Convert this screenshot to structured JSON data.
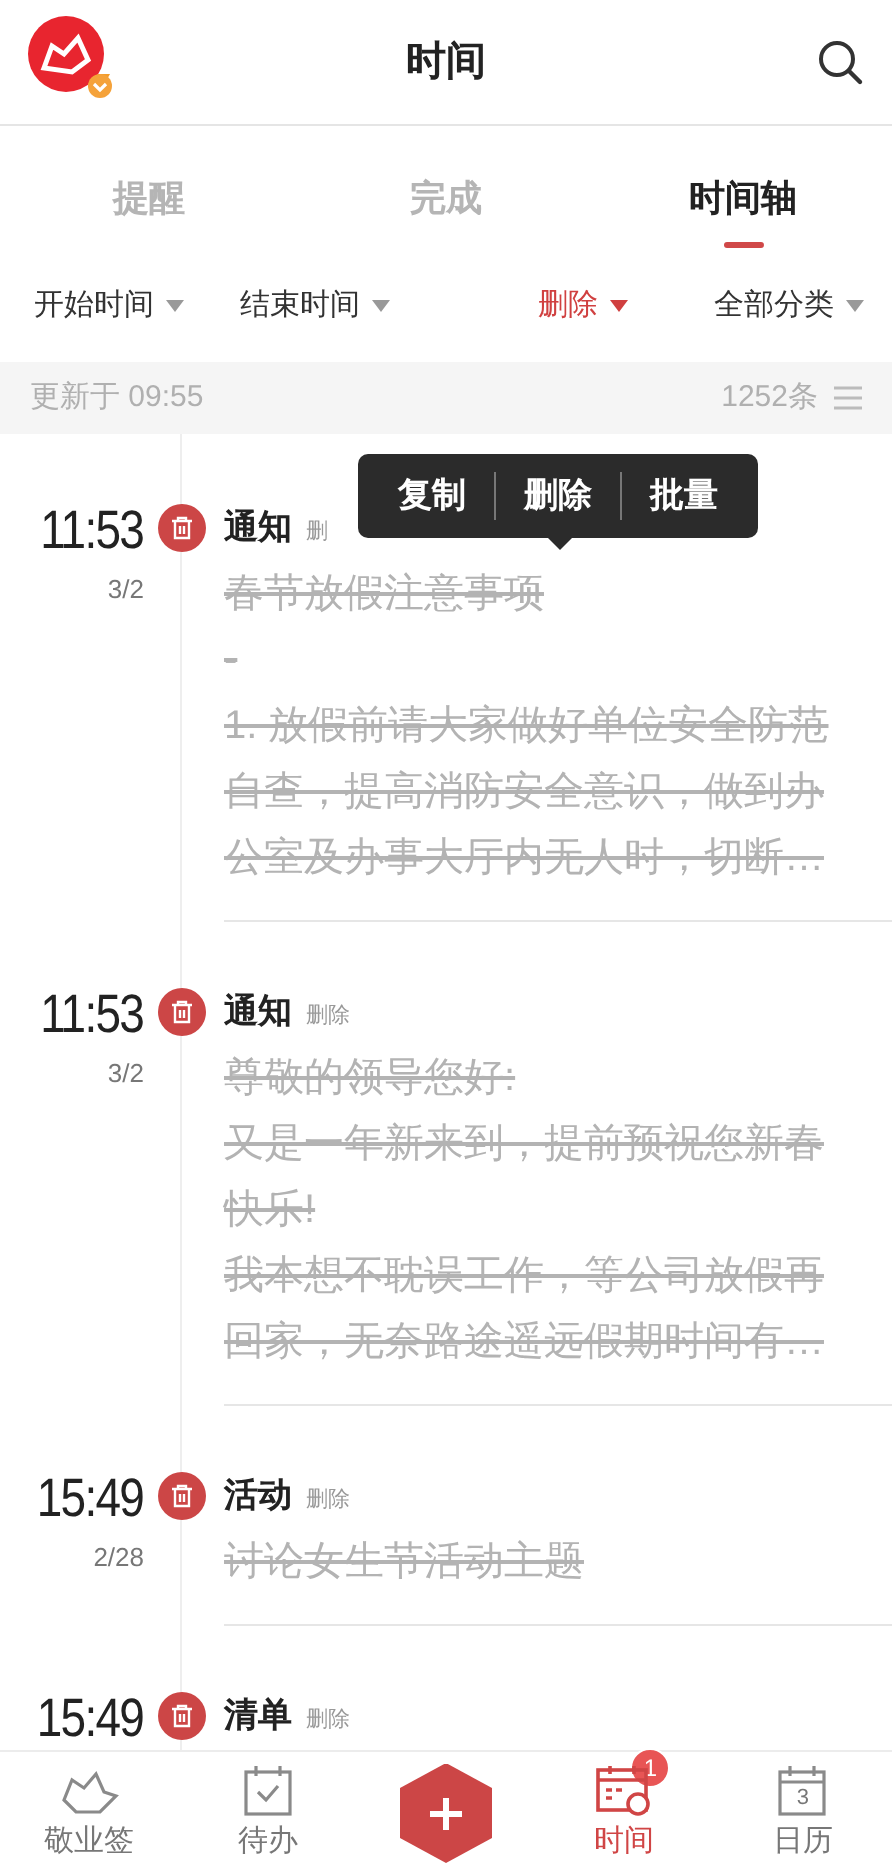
{
  "header": {
    "title": "时间"
  },
  "tabs": [
    {
      "label": "提醒",
      "selected": false
    },
    {
      "label": "完成",
      "selected": false
    },
    {
      "label": "时间轴",
      "selected": true
    }
  ],
  "filters": [
    {
      "label": "开始时间",
      "selected": false
    },
    {
      "label": "结束时间",
      "selected": false
    },
    {
      "label": "删除",
      "selected": true
    },
    {
      "label": "全部分类",
      "selected": false
    }
  ],
  "status_bar": {
    "updated": "更新于 09:55",
    "count": "1252条"
  },
  "popup_menu": [
    "复制",
    "删除",
    "批量"
  ],
  "entries": [
    {
      "time": "11:53",
      "date": "3/2",
      "category": "通知",
      "status": "删",
      "struck": true,
      "lines": [
        "春节放假注意事项",
        "-",
        "1. 放假前请大家做好单位安全防范",
        "自查，提高消防安全意识，做到办",
        "公室及办事大厅内无人时，切断…"
      ]
    },
    {
      "time": "11:53",
      "date": "3/2",
      "category": "通知",
      "status": "删除",
      "struck": true,
      "lines": [
        "尊敬的领导您好:",
        "又是一年新来到，提前预祝您新春",
        "快乐!",
        "我本想不耽误工作，等公司放假再",
        "回家，无奈路途遥远假期时间有…"
      ]
    },
    {
      "time": "15:49",
      "date": "2/28",
      "category": "活动",
      "status": "删除",
      "struck": true,
      "lines": [
        "讨论女生节活动主题"
      ]
    },
    {
      "time": "15:49",
      "category": "清单",
      "status": "删除"
    }
  ],
  "bottom_nav": [
    {
      "label": "敬业签",
      "selected": false,
      "kind": "logo"
    },
    {
      "label": "待办",
      "selected": false,
      "kind": "todo"
    },
    {
      "kind": "add"
    },
    {
      "label": "时间",
      "selected": true,
      "kind": "time",
      "badge": "1"
    },
    {
      "label": "日历",
      "selected": false,
      "kind": "calendar",
      "icon_text": "3"
    }
  ]
}
